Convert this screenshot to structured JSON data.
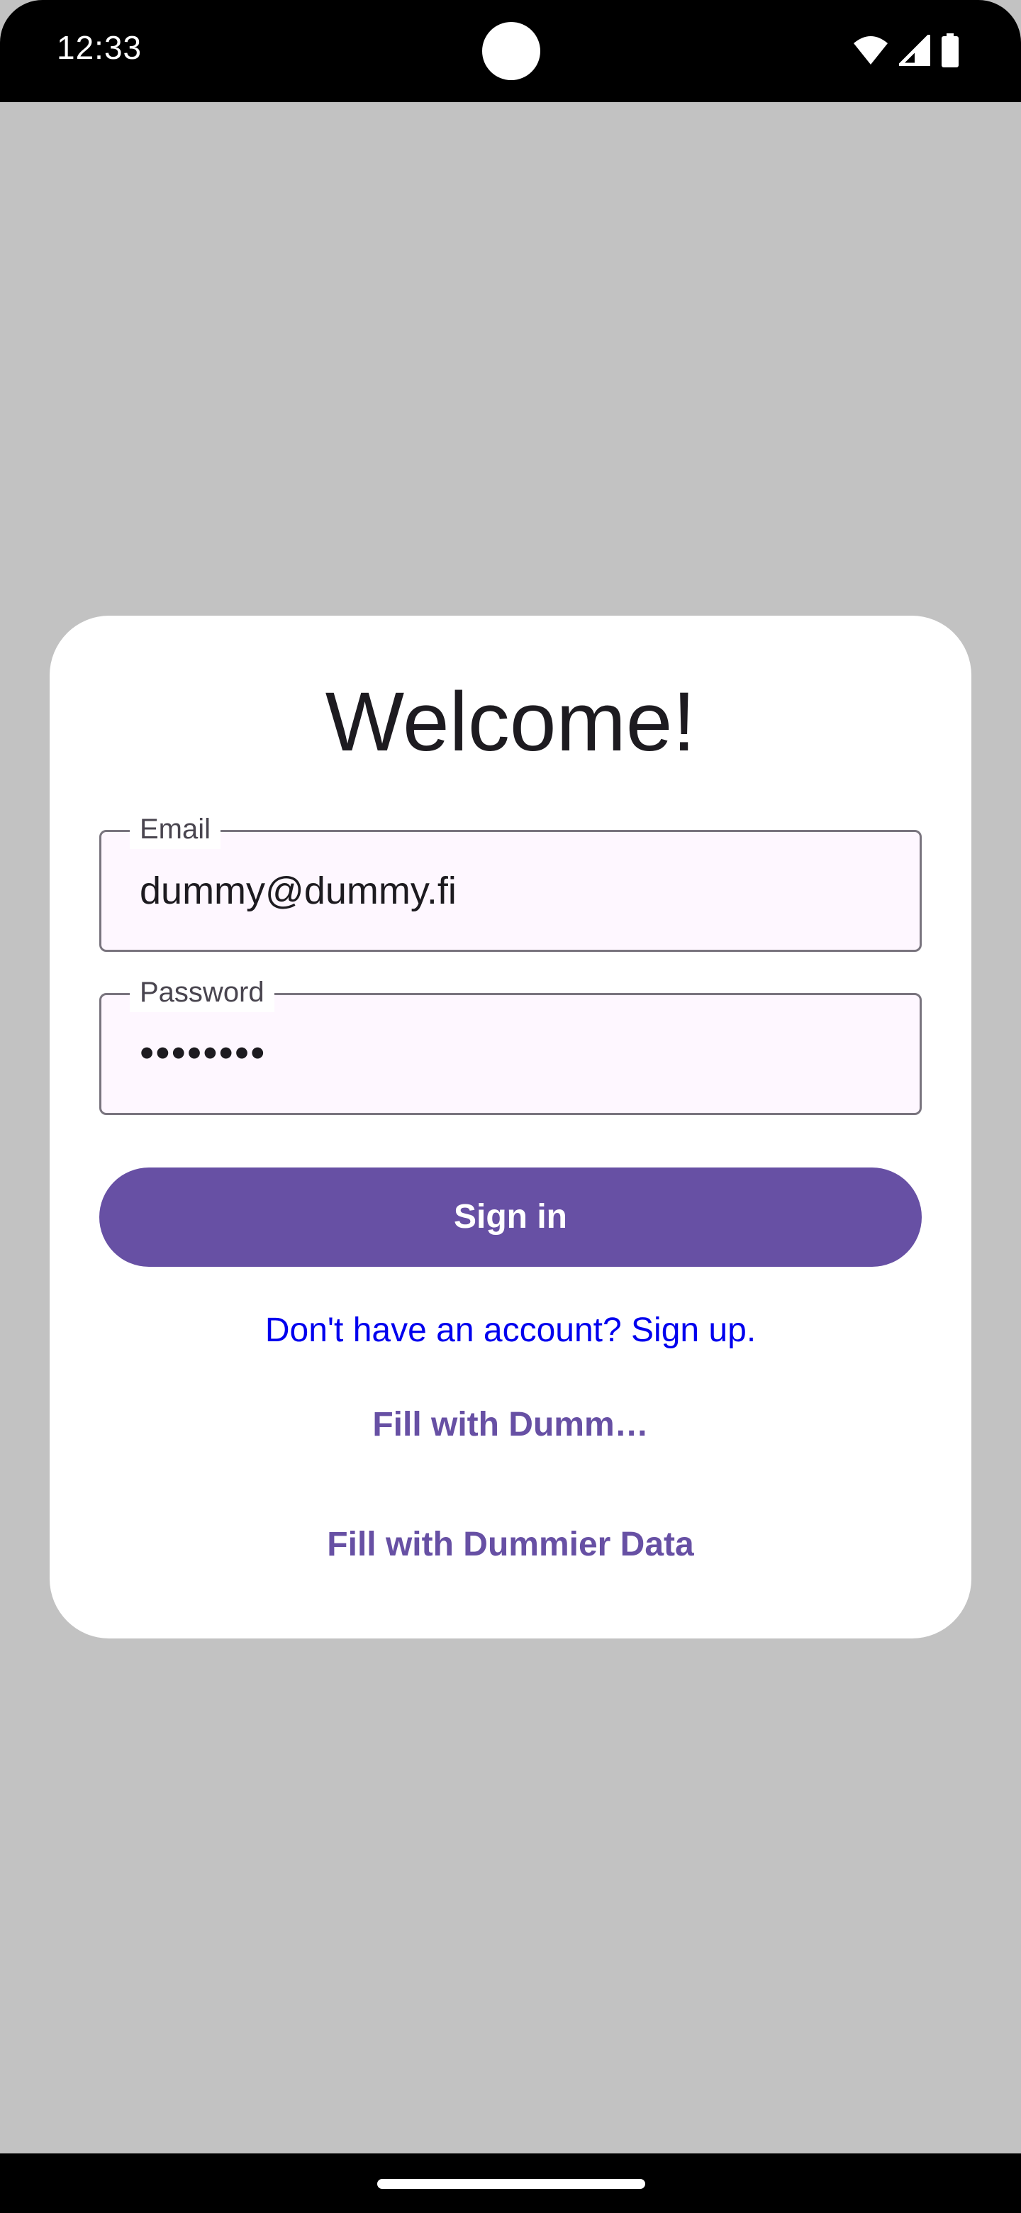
{
  "status_bar": {
    "time": "12:33",
    "icons": [
      "wifi-icon",
      "cell-signal-icon",
      "battery-icon"
    ]
  },
  "dialog": {
    "title": "Welcome!",
    "email": {
      "label": "Email",
      "value": "dummy@dummy.fi"
    },
    "password": {
      "label": "Password",
      "value": "••••••••"
    },
    "signin_label": "Sign in",
    "signup_link": "Don't have an account? Sign up.",
    "fill_dummy_label": "Fill with Dumm…",
    "fill_dummier_label": "Fill with Dummier Data"
  },
  "colors": {
    "primary": "#6750a4",
    "link": "#0000ee",
    "scrim": "#c2c2c2",
    "field_background": "#fef7ff",
    "field_border": "#79747e"
  }
}
